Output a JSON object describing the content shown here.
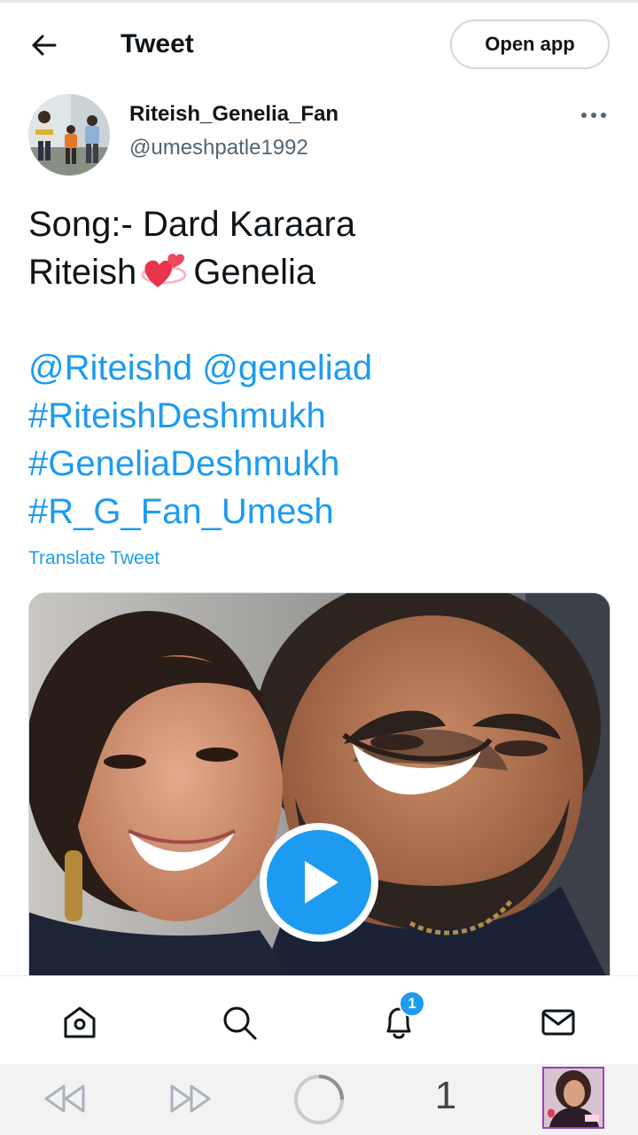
{
  "header": {
    "title": "Tweet",
    "open_app_label": "Open app"
  },
  "author": {
    "display_name": "Riteish_Genelia_Fan",
    "handle": "@umeshpatle1992"
  },
  "tweet": {
    "line1": "Song:- Dard Karaara",
    "line2_a": "Riteish",
    "line2_emoji": "revolving-hearts-emoji",
    "line2_b": "Genelia",
    "mention1": "@Riteishd",
    "mention2": "@geneliad",
    "hashtag1": "#RiteishDeshmukh",
    "hashtag2": "#GeneliaDeshmukh",
    "hashtag3": "#R_G_Fan_Umesh",
    "translate_label": "Translate Tweet"
  },
  "media": {
    "type": "video",
    "play_icon": "play-icon"
  },
  "tabbar": {
    "items": [
      "home-icon",
      "search-icon",
      "bell-icon",
      "mail-icon"
    ],
    "notification_count": "1"
  },
  "browser_nav": {
    "tab_count": "1",
    "items": [
      "rewind-icon",
      "fast-forward-icon",
      "loading-circle-icon",
      "tab-count",
      "thumbnail"
    ]
  },
  "colors": {
    "accent": "#1d9bf0",
    "text": "#0f1419",
    "secondary_text": "#536471",
    "border": "#cfd9de"
  }
}
